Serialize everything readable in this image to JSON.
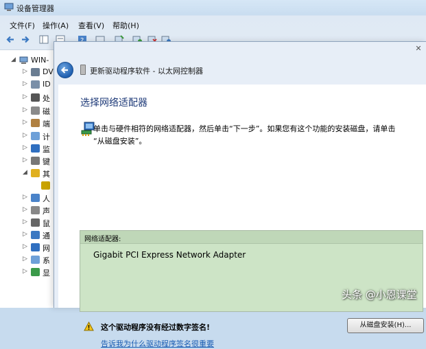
{
  "background_window": {
    "title": "设备管理器",
    "menu": [
      "文件(F)",
      "操作(A)",
      "查看(V)",
      "帮助(H)"
    ],
    "tree_root": "WIN-",
    "tree_items": [
      {
        "label": "DV",
        "icon": "dvd-drive-icon"
      },
      {
        "label": "ID",
        "icon": "ide-controller-icon"
      },
      {
        "label": "处",
        "icon": "processor-icon"
      },
      {
        "label": "磁",
        "icon": "disk-drive-icon"
      },
      {
        "label": "端",
        "icon": "port-icon"
      },
      {
        "label": "计",
        "icon": "computer-icon"
      },
      {
        "label": "监",
        "icon": "monitor-icon"
      },
      {
        "label": "键",
        "icon": "keyboard-icon"
      },
      {
        "label": "其",
        "icon": "other-devices-icon"
      },
      {
        "label": "",
        "icon": "unknown-device-icon"
      },
      {
        "label": "人",
        "icon": "hid-icon"
      },
      {
        "label": "声",
        "icon": "audio-icon"
      },
      {
        "label": "鼠",
        "icon": "mouse-icon"
      },
      {
        "label": "通",
        "icon": "usb-controller-icon"
      },
      {
        "label": "网",
        "icon": "network-adapter-icon"
      },
      {
        "label": "系",
        "icon": "system-devices-icon"
      },
      {
        "label": "显",
        "icon": "display-adapter-icon"
      }
    ]
  },
  "dialog": {
    "close_glyph": "✕",
    "heading": "更新驱动程序软件 - 以太网控制器",
    "section_title": "选择网络适配器",
    "instruction_line1": "单击与硬件相符的网络适配器，然后单击“下一步”。如果您有这个功能的安装磁盘，请单击",
    "instruction_line2": "“从磁盘安装”。",
    "list_header": "网络适配器:",
    "list_items": [
      "Gigabit PCI Express Network Adapter"
    ],
    "warning_text": "这个驱动程序没有经过数字签名!",
    "install_button": "从磁盘安装(H)...",
    "help_link": "告诉我为什么驱动程序签名很重要"
  },
  "watermark": "头条 @小恩课堂",
  "colors": {
    "list_bg": "#cde4c6",
    "link": "#1a5db3",
    "section_title": "#1e3a78"
  }
}
